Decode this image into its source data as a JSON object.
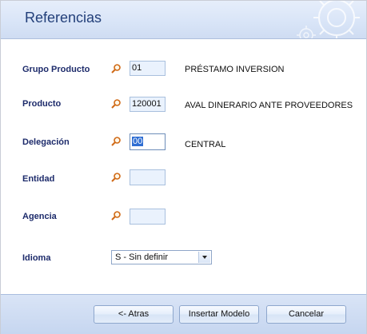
{
  "header": {
    "title": "Referencias"
  },
  "form": {
    "grupo_producto": {
      "label": "Grupo Producto",
      "value": "01",
      "description": "PRÉSTAMO INVERSION"
    },
    "producto": {
      "label": "Producto",
      "value": "120001",
      "description": "AVAL DINERARIO ANTE PROVEEDORES"
    },
    "delegacion": {
      "label": "Delegación",
      "value": "00",
      "description": "CENTRAL"
    },
    "entidad": {
      "label": "Entidad",
      "value": ""
    },
    "agencia": {
      "label": "Agencia",
      "value": ""
    },
    "idioma": {
      "label": "Idioma",
      "selected": "S - Sin definir"
    }
  },
  "footer": {
    "back_label": "<-  Atras",
    "insert_label": "Insertar Modelo",
    "cancel_label": "Cancelar"
  },
  "icons": {
    "lookup": "magnifier-icon",
    "decoration": "gear-icon"
  },
  "colors": {
    "label": "#1d2b6b",
    "title": "#23407a",
    "header_bg": "#d8e4f7"
  }
}
